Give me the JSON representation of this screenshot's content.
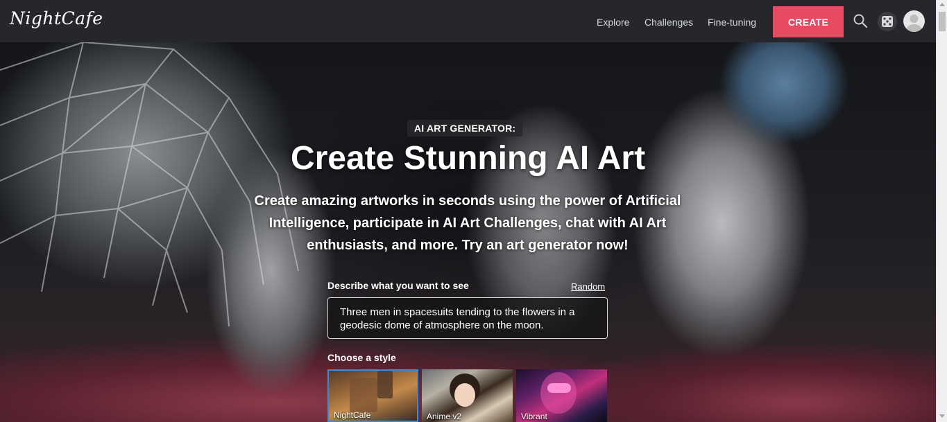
{
  "header": {
    "logo": "NightCafe",
    "nav": [
      {
        "label": "Explore"
      },
      {
        "label": "Challenges"
      },
      {
        "label": "Fine-tuning"
      }
    ],
    "create_label": "CREATE",
    "icons": [
      "search-icon",
      "dice-icon",
      "avatar-icon"
    ],
    "accent_color": "#e74b62"
  },
  "hero": {
    "badge": "AI ART GENERATOR:",
    "headline": "Create Stunning AI Art",
    "subtitle": "Create amazing artworks in seconds using the power of Artificial Intelligence, participate in AI Art Challenges, chat with AI Art enthusiasts, and more. Try an art generator now!",
    "prompt_label": "Describe what you want to see",
    "random_label": "Random",
    "prompt_value": "Three men in spacesuits tending to the flowers in a geodesic dome of atmosphere on the moon.",
    "style_label": "Choose a style",
    "styles": [
      {
        "name": "NightCafe",
        "selected": true
      },
      {
        "name": "Anime v2",
        "selected": false
      },
      {
        "name": "Vibrant",
        "selected": false
      }
    ]
  }
}
